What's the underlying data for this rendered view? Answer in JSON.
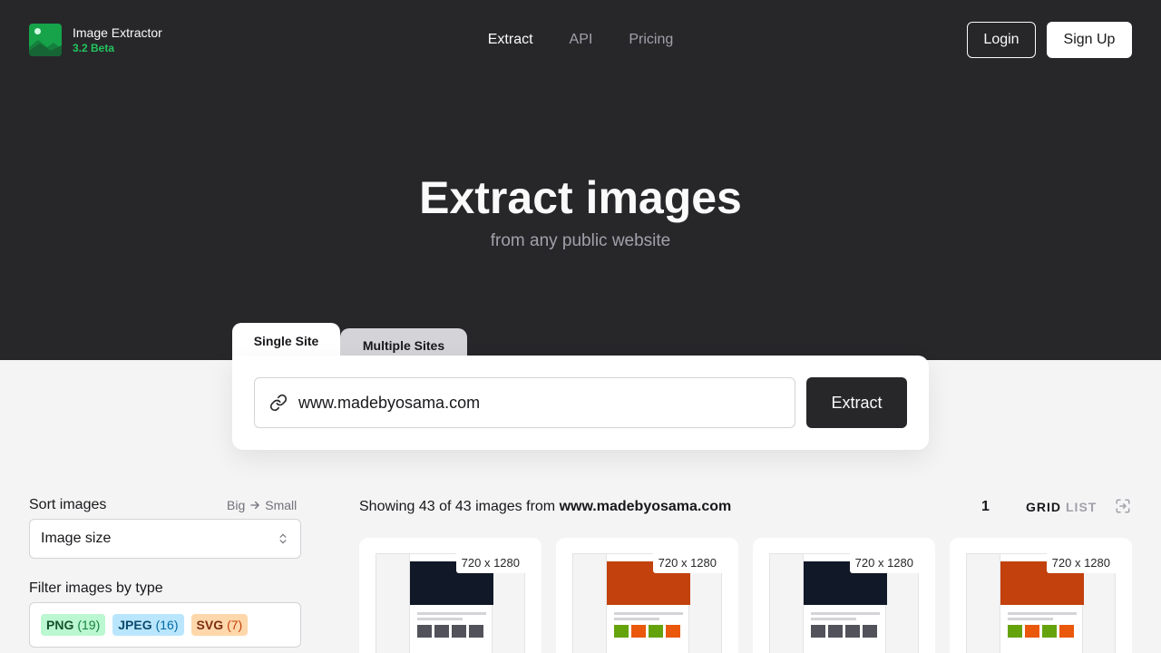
{
  "app": {
    "name": "Image Extractor",
    "version": "3.2 Beta"
  },
  "nav": {
    "items": [
      {
        "label": "Extract",
        "active": true
      },
      {
        "label": "API",
        "active": false
      },
      {
        "label": "Pricing",
        "active": false
      }
    ]
  },
  "auth": {
    "login_label": "Login",
    "signup_label": "Sign Up"
  },
  "hero": {
    "title": "Extract images",
    "subtitle": "from any public website"
  },
  "tabs": {
    "single": "Single Site",
    "multiple": "Multiple Sites"
  },
  "search": {
    "value": "www.madebyosama.com",
    "extract_label": "Extract"
  },
  "sidebar": {
    "sort_label": "Sort images",
    "sort_from": "Big",
    "sort_to": "Small",
    "sort_value": "Image size",
    "filter_label": "Filter images by type",
    "filters": [
      {
        "type": "PNG",
        "count": "(19)"
      },
      {
        "type": "JPEG",
        "count": "(16)"
      },
      {
        "type": "SVG",
        "count": "(7)"
      }
    ]
  },
  "results": {
    "prefix": "Showing 43 of 43 images from ",
    "domain": "www.madebyosama.com",
    "page": "1",
    "view_grid": "GRID",
    "view_list": "LIST",
    "cards": [
      {
        "dims": "720 x 1280",
        "theme": "security",
        "hero_text": "TOP LEVEL OF SECURITY SERVICE"
      },
      {
        "dims": "720 x 1280",
        "theme": "food",
        "hero_text": "Feed REAL"
      },
      {
        "dims": "720 x 1280",
        "theme": "security",
        "hero_text": "TOP LEVEL OF SECURITY SERVICE"
      },
      {
        "dims": "720 x 1280",
        "theme": "food",
        "hero_text": "Feed REAL"
      }
    ]
  },
  "colors": {
    "hero_bg": "#27272a",
    "accent": "#22c55e",
    "page_bg": "#f4f4f5"
  }
}
